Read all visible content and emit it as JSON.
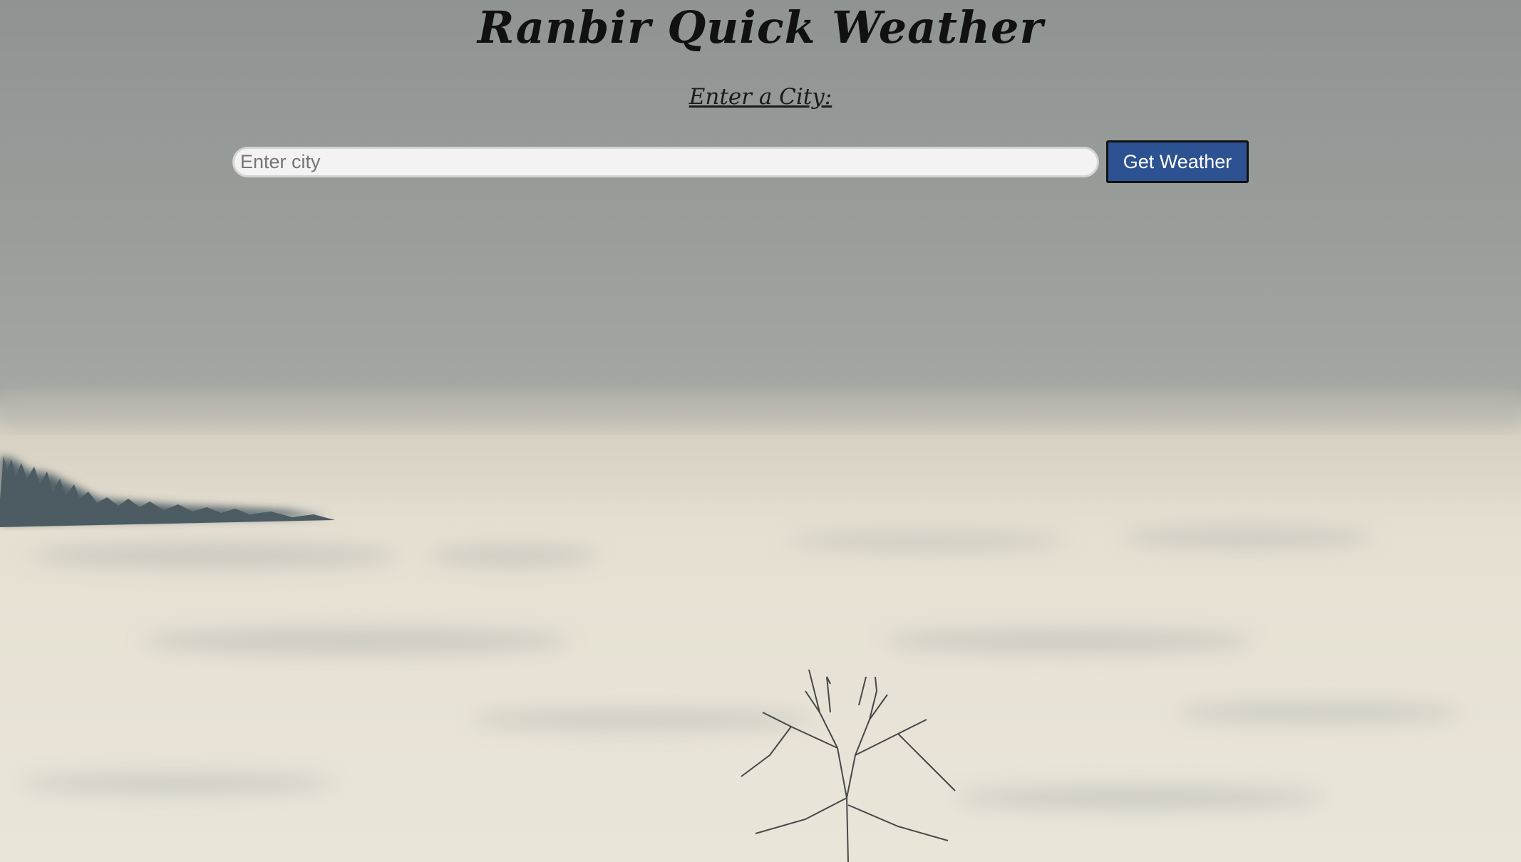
{
  "header": {
    "title": "Ranbir Quick Weather",
    "subtitle": "Enter a City:"
  },
  "search": {
    "placeholder": "Enter city",
    "value": "",
    "button_label": "Get Weather"
  },
  "colors": {
    "button_bg": "#2c5291",
    "button_text": "#ffffff",
    "input_bg": "#f3f3f3"
  },
  "background": {
    "icon": "sea-of-clouds-landscape-image"
  }
}
